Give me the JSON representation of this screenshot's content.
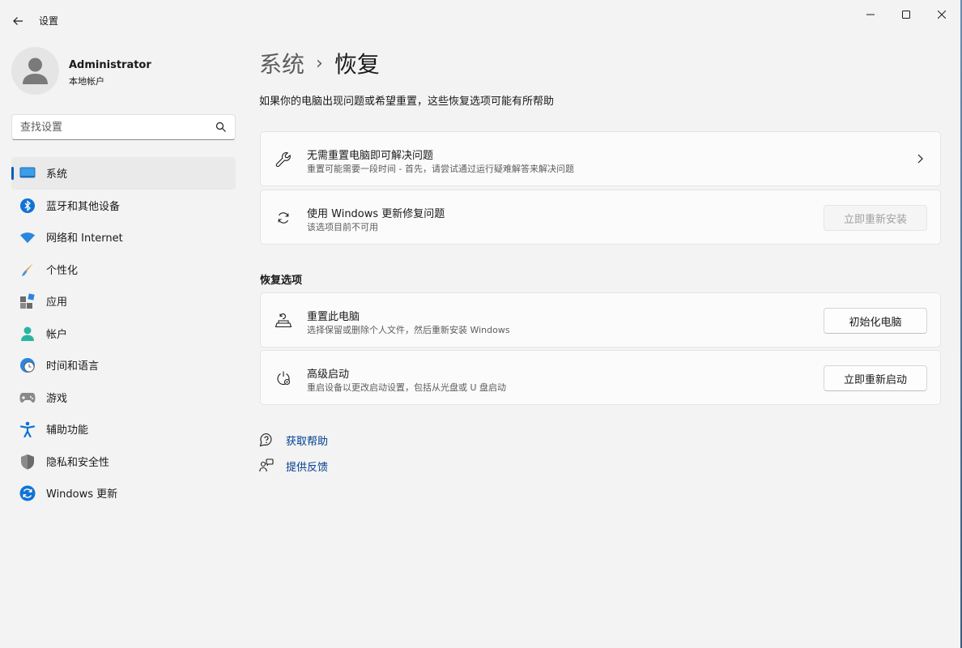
{
  "window": {
    "title": "设置"
  },
  "profile": {
    "name": "Administrator",
    "account_type": "本地帐户"
  },
  "search": {
    "placeholder": "查找设置"
  },
  "sidebar": {
    "items": [
      {
        "label": "系统",
        "icon": "system-icon",
        "active": true
      },
      {
        "label": "蓝牙和其他设备",
        "icon": "bluetooth-icon"
      },
      {
        "label": "网络和 Internet",
        "icon": "wifi-icon"
      },
      {
        "label": "个性化",
        "icon": "paintbrush-icon"
      },
      {
        "label": "应用",
        "icon": "apps-icon"
      },
      {
        "label": "帐户",
        "icon": "account-icon"
      },
      {
        "label": "时间和语言",
        "icon": "globe-clock-icon"
      },
      {
        "label": "游戏",
        "icon": "gamepad-icon"
      },
      {
        "label": "辅助功能",
        "icon": "accessibility-icon"
      },
      {
        "label": "隐私和安全性",
        "icon": "shield-icon"
      },
      {
        "label": "Windows 更新",
        "icon": "windows-update-icon"
      }
    ]
  },
  "breadcrumb": {
    "parent": "系统",
    "separator": "›",
    "current": "恢复"
  },
  "page": {
    "description": "如果你的电脑出现问题或希望重置，这些恢复选项可能有所帮助"
  },
  "cards": {
    "troubleshoot": {
      "title": "无需重置电脑即可解决问题",
      "subtitle": "重置可能需要一段时间 - 首先，请尝试通过运行疑难解答来解决问题",
      "icon": "wrench-icon"
    },
    "windows_update_fix": {
      "title": "使用 Windows 更新修复问题",
      "subtitle": "该选项目前不可用",
      "button": "立即重新安装",
      "icon": "sync-icon"
    }
  },
  "recovery_options": {
    "heading": "恢复选项",
    "reset": {
      "title": "重置此电脑",
      "subtitle": "选择保留或删除个人文件，然后重新安装 Windows",
      "button": "初始化电脑",
      "icon": "reset-pc-icon"
    },
    "advanced_startup": {
      "title": "高级启动",
      "subtitle": "重启设备以更改启动设置，包括从光盘或 U 盘启动",
      "button": "立即重新启动",
      "icon": "advanced-startup-icon"
    }
  },
  "links": {
    "get_help": "获取帮助",
    "feedback": "提供反馈"
  },
  "colors": {
    "accent": "#005fb8",
    "link": "#003e92",
    "background": "#f3f3f3",
    "card": "#fbfbfb"
  }
}
